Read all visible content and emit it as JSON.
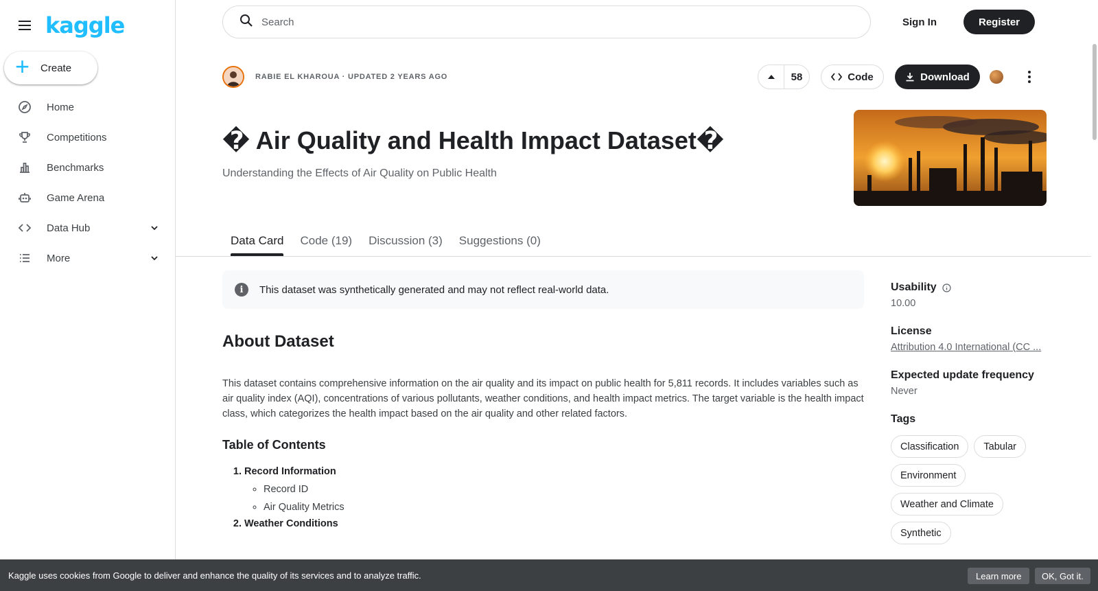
{
  "app": {
    "logo": "kaggle",
    "create_label": "Create"
  },
  "sidebar": {
    "items": [
      {
        "label": "Home",
        "icon": "compass-icon"
      },
      {
        "label": "Competitions",
        "icon": "trophy-icon"
      },
      {
        "label": "Benchmarks",
        "icon": "bar-chart-icon"
      },
      {
        "label": "Game Arena",
        "icon": "robot-icon"
      },
      {
        "label": "Data Hub",
        "icon": "code-brackets-icon",
        "expandable": true
      },
      {
        "label": "More",
        "icon": "list-icon",
        "expandable": true
      }
    ]
  },
  "topbar": {
    "search_placeholder": "Search",
    "signin_label": "Sign In",
    "register_label": "Register"
  },
  "dataset": {
    "owner_line": "RABIE EL KHAROUA · UPDATED 2 YEARS AGO",
    "upvotes": "58",
    "code_label": "Code",
    "download_label": "Download",
    "title": "� Air Quality and Health Impact Dataset�",
    "subtitle": "Understanding the Effects of Air Quality on Public Health"
  },
  "tabs": [
    {
      "label": "Data Card",
      "active": true
    },
    {
      "label": "Code (19)",
      "active": false
    },
    {
      "label": "Discussion (3)",
      "active": false
    },
    {
      "label": "Suggestions (0)",
      "active": false
    }
  ],
  "notice": {
    "text": "This dataset was synthetically generated and may not reflect real-world data."
  },
  "content": {
    "about_heading": "About Dataset",
    "about_text": "This dataset contains comprehensive information on the air quality and its impact on public health for 5,811 records. It includes variables such as air quality index (AQI), concentrations of various pollutants, weather conditions, and health impact metrics. The target variable is the health impact class, which categorizes the health impact based on the air quality and other related factors.",
    "toc_heading": "Table of Contents",
    "toc": [
      {
        "title": "Record Information",
        "items": [
          "Record ID",
          "Air Quality Metrics"
        ]
      },
      {
        "title": "Weather Conditions",
        "items": []
      }
    ]
  },
  "meta": {
    "usability_label": "Usability",
    "usability_value": "10.00",
    "license_label": "License",
    "license_value": "Attribution 4.0 International (CC ...",
    "frequency_label": "Expected update frequency",
    "frequency_value": "Never",
    "tags_label": "Tags",
    "tags": [
      "Classification",
      "Tabular",
      "Environment",
      "Weather and Climate",
      "Synthetic"
    ]
  },
  "cookie": {
    "text": "Kaggle uses cookies from Google to deliver and enhance the quality of its services and to analyze traffic.",
    "learn_more": "Learn more",
    "ok": "OK, Got it."
  }
}
